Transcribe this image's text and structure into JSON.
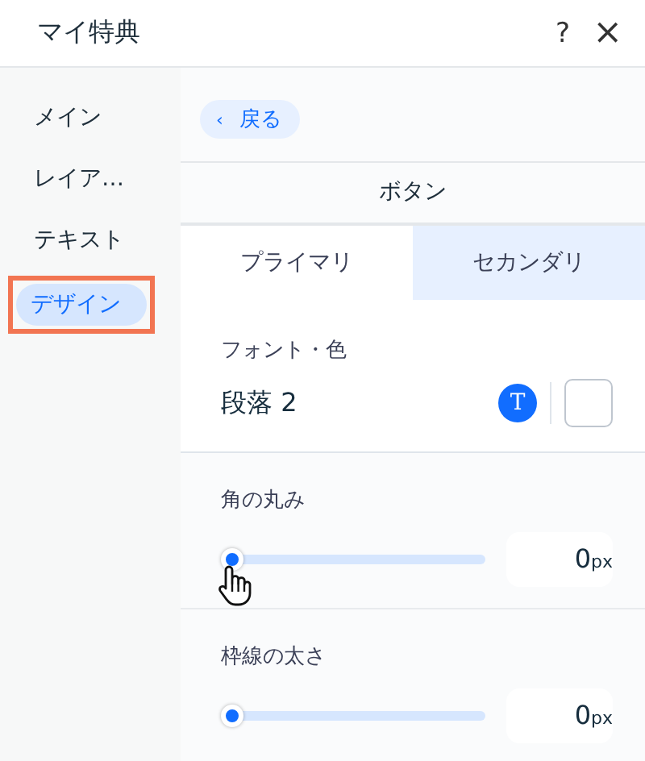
{
  "window": {
    "title": "マイ特典",
    "help": "?",
    "close": "×"
  },
  "sidebar": {
    "items": [
      {
        "label": "メイン",
        "selected": false,
        "highlighted": false
      },
      {
        "label": "レイア…",
        "selected": false,
        "highlighted": false
      },
      {
        "label": "テキスト",
        "selected": false,
        "highlighted": false
      },
      {
        "label": "デザイン",
        "selected": true,
        "highlighted": true
      }
    ]
  },
  "back_button": {
    "arrow": "‹",
    "label": "戻る"
  },
  "section_title": "ボタン",
  "tabs": [
    {
      "label": "プライマリ",
      "selected": true
    },
    {
      "label": "セカンダリ",
      "selected": false
    }
  ],
  "font_color": {
    "label": "フォント・色",
    "value": "段落 2",
    "text_icon": "T"
  },
  "sliders": [
    {
      "label": "角の丸み",
      "level": 0,
      "value": "0",
      "unit": "px",
      "cursor": true
    },
    {
      "label": "枠線の太さ",
      "level": 0,
      "value": "0",
      "unit": "px",
      "cursor": false
    }
  ]
}
